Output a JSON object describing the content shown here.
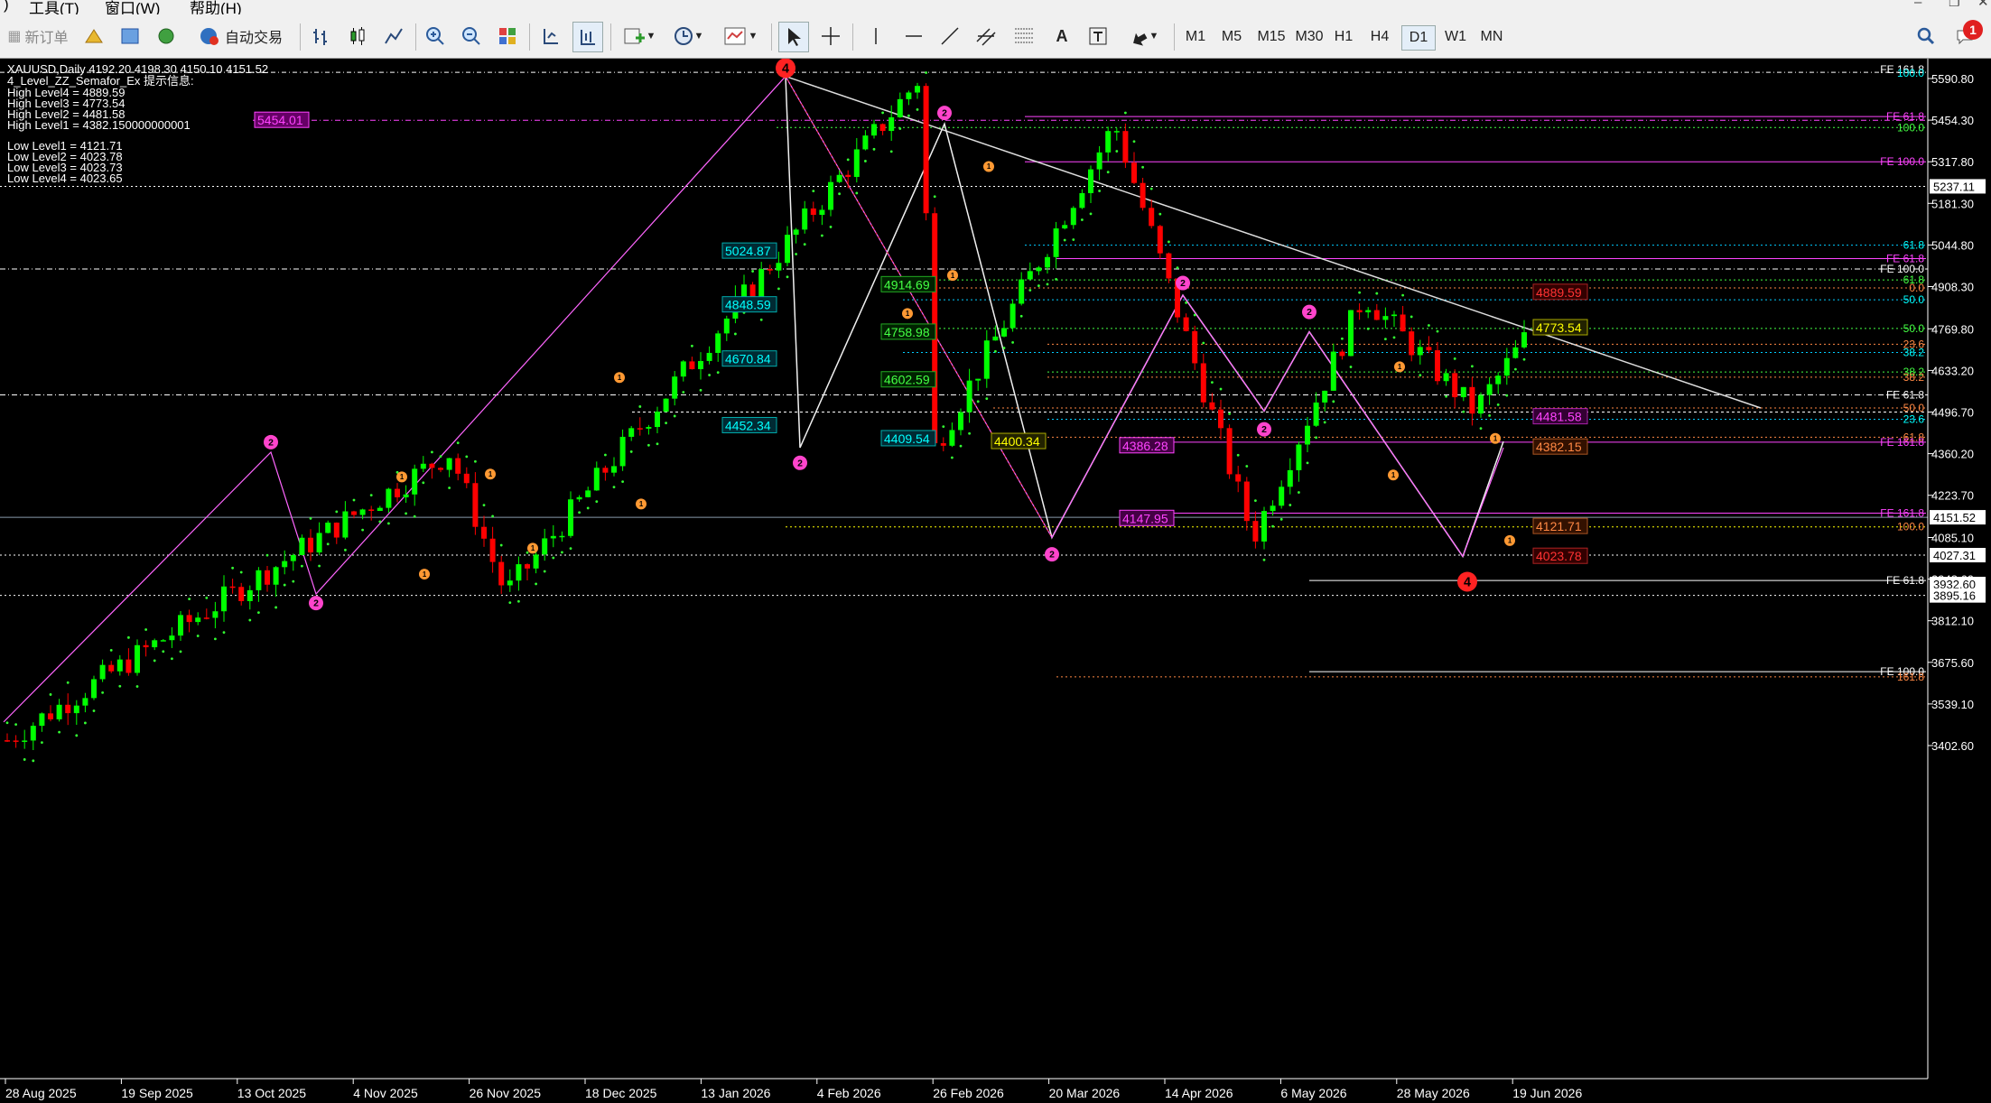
{
  "menu": {
    "tools": "工具(T)",
    "window": "窗口(W)",
    "help": "帮助(H)"
  },
  "toolbar": {
    "new_order": "新订单",
    "auto_trading": "自动交易",
    "timeframes": [
      "M1",
      "M5",
      "M15",
      "M30",
      "H1",
      "H4",
      "D1",
      "W1",
      "MN"
    ],
    "active_timeframe": "D1",
    "notification_count": "1"
  },
  "chart_info": {
    "header": "XAUUSD,Daily  4192.20 4198.30 4150.10 4151.52",
    "indicator_title": "4_Level_ZZ_Semafor_Ex 提示信息:",
    "high_levels": [
      "High Level4 = 4889.59",
      "High Level3 = 4773.54",
      "High Level2 = 4481.58",
      "High Level1 = 4382.150000000001"
    ],
    "low_levels": [
      "Low Level1 = 4121.71",
      "Low Level2 = 4023.78",
      "Low Level3 = 4023.73",
      "Low Level4 = 4023.65"
    ]
  },
  "chart_data": {
    "type": "candlestick",
    "symbol": "XAUUSD",
    "timeframe": "Daily",
    "ohlc_last": {
      "open": 4192.2,
      "high": 4198.3,
      "low": 4150.1,
      "close": 4151.52
    },
    "ylim": [
      3340,
      5660
    ],
    "x_dates": [
      "28 Aug 2025",
      "19 Sep 2025",
      "13 Oct 2025",
      "4 Nov 2025",
      "26 Nov 2025",
      "18 Dec 2025",
      "13 Jan 2026",
      "4 Feb 2026",
      "26 Feb 2026",
      "20 Mar 2026",
      "14 Apr 2026",
      "6 May 2026",
      "28 May 2026",
      "19 Jun 2026"
    ],
    "y_ticks": [
      5590.8,
      5454.3,
      5317.8,
      5181.3,
      5044.8,
      4908.3,
      4769.8,
      4633.2,
      4496.7,
      4360.2,
      4223.7,
      4085.1,
      3948.6,
      3812.1,
      3675.6,
      3539.1,
      3402.6
    ],
    "price_tags": [
      {
        "value": 5237.11,
        "text": "5237.11"
      },
      {
        "value": 4151.52,
        "text": "4151.52"
      },
      {
        "value": 4027.31,
        "text": "4027.31"
      },
      {
        "value": 3932.6,
        "text": "3932.60"
      },
      {
        "value": 3895.16,
        "text": "3895.16"
      }
    ],
    "labels": [
      {
        "text": "5454.01",
        "y": 5454.01,
        "color": "#ff44ff",
        "border": "#ff44ff",
        "fill": "#660066"
      },
      {
        "text": "5024.87",
        "y": 5024.87,
        "color": "#00ffff",
        "border": "#00aaaa",
        "fill": "#002a33"
      },
      {
        "text": "4914.69",
        "y": 4914.69,
        "color": "#44ff44",
        "border": "#22aa22",
        "fill": "#002200"
      },
      {
        "text": "4848.59",
        "y": 4848.59,
        "color": "#00ffff",
        "border": "#00aaaa",
        "fill": "#002a33"
      },
      {
        "text": "4758.98",
        "y": 4758.98,
        "color": "#44ff44",
        "border": "#22aa22",
        "fill": "#002200"
      },
      {
        "text": "4670.84",
        "y": 4670.84,
        "color": "#00ffff",
        "border": "#00aaaa",
        "fill": "#002a33"
      },
      {
        "text": "4602.59",
        "y": 4602.59,
        "color": "#44ff44",
        "border": "#22aa22",
        "fill": "#002200"
      },
      {
        "text": "4452.34",
        "y": 4452.34,
        "color": "#00ffff",
        "border": "#00aaaa",
        "fill": "#002a33"
      },
      {
        "text": "4409.54",
        "y": 4409.54,
        "color": "#00ffff",
        "border": "#00aaaa",
        "fill": "#002a33"
      },
      {
        "text": "4400.34",
        "y": 4400.34,
        "color": "#ffff00",
        "border": "#aaaa00",
        "fill": "#222200"
      },
      {
        "text": "4386.28",
        "y": 4386.28,
        "color": "#ff44ff",
        "border": "#ff44ff",
        "fill": "#440044"
      },
      {
        "text": "4147.95",
        "y": 4147.95,
        "color": "#ff44ff",
        "border": "#ff44ff",
        "fill": "#440044"
      },
      {
        "text": "4889.59",
        "y": 4889.59,
        "color": "#ff3333",
        "border": "#aa2222",
        "fill": "#330000"
      },
      {
        "text": "4773.54",
        "y": 4773.54,
        "color": "#ffff00",
        "border": "#aaaa00",
        "fill": "#222200"
      },
      {
        "text": "4481.58",
        "y": 4481.58,
        "color": "#ff44ff",
        "border": "#aa22aa",
        "fill": "#330033"
      },
      {
        "text": "4382.15",
        "y": 4382.15,
        "color": "#ff8844",
        "border": "#aa5522",
        "fill": "#331100"
      },
      {
        "text": "4121.71",
        "y": 4121.71,
        "color": "#ff8844",
        "border": "#aa5522",
        "fill": "#331100"
      },
      {
        "text": "4023.78",
        "y": 4023.78,
        "color": "#ff3333",
        "border": "#aa2222",
        "fill": "#330000"
      }
    ],
    "fib_labels": [
      {
        "text": "FE 161.8",
        "y": 5620,
        "color": "#ffffff"
      },
      {
        "text": "100.0",
        "y": 5608,
        "color": "#00ffff"
      },
      {
        "text": "FE 61.8",
        "y": 5466,
        "color": "#ff44ff"
      },
      {
        "text": "100.0",
        "y": 5430,
        "color": "#44ff44"
      },
      {
        "text": "FE 100.0",
        "y": 5317.8,
        "color": "#ff44ff"
      },
      {
        "text": "61.8",
        "y": 5044,
        "color": "#00ffff"
      },
      {
        "text": "FE 61.8",
        "y": 5000,
        "color": "#ff44ff"
      },
      {
        "text": "FE 100.0",
        "y": 4966,
        "color": "#ffffff"
      },
      {
        "text": "61.8",
        "y": 4930,
        "color": "#44ff44"
      },
      {
        "text": "0.0",
        "y": 4904,
        "color": "#ff8844"
      },
      {
        "text": "50.0",
        "y": 4865,
        "color": "#00ffff"
      },
      {
        "text": "50.0",
        "y": 4771,
        "color": "#44ff44"
      },
      {
        "text": "23.6",
        "y": 4719,
        "color": "#ff8844"
      },
      {
        "text": "38.2",
        "y": 4692,
        "color": "#00ffff"
      },
      {
        "text": "38.2",
        "y": 4628,
        "color": "#44ff44"
      },
      {
        "text": "38.2",
        "y": 4611,
        "color": "#ff8844"
      },
      {
        "text": "FE 61.8",
        "y": 4553,
        "color": "#ffffff"
      },
      {
        "text": "50.0",
        "y": 4510,
        "color": "#ff8844"
      },
      {
        "text": "23.6",
        "y": 4473,
        "color": "#00ffff"
      },
      {
        "text": "61.8",
        "y": 4414,
        "color": "#ff8844"
      },
      {
        "text": "FE 161.8",
        "y": 4398,
        "color": "#ff44ff"
      },
      {
        "text": "FE 161.8",
        "y": 4165,
        "color": "#ff44ff"
      },
      {
        "text": "100.0",
        "y": 4120,
        "color": "#ff8844"
      },
      {
        "text": "FE 61.8",
        "y": 3944,
        "color": "#ffffff"
      },
      {
        "text": "FE 100.0",
        "y": 3645,
        "color": "#ffffff"
      },
      {
        "text": "161.8",
        "y": 3628,
        "color": "#ff8844"
      }
    ],
    "semafor_markers": [
      {
        "label": "4",
        "date_index": 13.8,
        "price": 5625,
        "color": "#ff2222",
        "size": "big"
      },
      {
        "label": "2",
        "date_index": 5.2,
        "price": 4398,
        "color": "#ff44cc",
        "size": "mid"
      },
      {
        "label": "2",
        "date_index": 6.3,
        "price": 3870,
        "color": "#ff44cc",
        "size": "mid"
      },
      {
        "label": "2",
        "date_index": 14.2,
        "price": 4330,
        "color": "#ff44cc",
        "size": "mid"
      },
      {
        "label": "2",
        "date_index": 16.8,
        "price": 5478,
        "color": "#ff44cc",
        "size": "mid"
      },
      {
        "label": "2",
        "date_index": 18.9,
        "price": 4030,
        "color": "#ff44cc",
        "size": "mid"
      },
      {
        "label": "2",
        "date_index": 21.2,
        "price": 4920,
        "color": "#ff44cc",
        "size": "mid"
      },
      {
        "label": "2",
        "date_index": 22.6,
        "price": 4440,
        "color": "#ff44cc",
        "size": "mid"
      },
      {
        "label": "2",
        "date_index": 23.4,
        "price": 4825,
        "color": "#ff44cc",
        "size": "mid"
      },
      {
        "label": "4",
        "date_index": 26.3,
        "price": 3940,
        "color": "#ff2222",
        "size": "big"
      },
      {
        "label": "1",
        "date_index": 7.2,
        "price": 4284,
        "color": "#ff9933",
        "size": "small"
      },
      {
        "label": "1",
        "date_index": 7.6,
        "price": 3965,
        "color": "#ff9933",
        "size": "small"
      },
      {
        "label": "1",
        "date_index": 8.7,
        "price": 4293,
        "color": "#ff9933",
        "size": "small"
      },
      {
        "label": "1",
        "date_index": 9.5,
        "price": 4050,
        "color": "#ff9933",
        "size": "small"
      },
      {
        "label": "1",
        "date_index": 11.1,
        "price": 4610,
        "color": "#ff9933",
        "size": "small"
      },
      {
        "label": "1",
        "date_index": 11.5,
        "price": 4195,
        "color": "#ff9933",
        "size": "small"
      },
      {
        "label": "1",
        "date_index": 15.8,
        "price": 4820,
        "color": "#ff9933",
        "size": "small"
      },
      {
        "label": "1",
        "date_index": 17.0,
        "price": 4945,
        "color": "#ff9933",
        "size": "small"
      },
      {
        "label": "1",
        "date_index": 17.7,
        "price": 5302,
        "color": "#ff9933",
        "size": "small"
      },
      {
        "label": "1",
        "date_index": 25.1,
        "price": 4645,
        "color": "#ff9933",
        "size": "small"
      },
      {
        "label": "1",
        "date_index": 25.0,
        "price": 4290,
        "color": "#ff9933",
        "size": "small"
      },
      {
        "label": "1",
        "date_index": 26.8,
        "price": 4410,
        "color": "#ff9933",
        "size": "small"
      },
      {
        "label": "1",
        "date_index": 27.1,
        "price": 4075,
        "color": "#ff9933",
        "size": "small"
      }
    ],
    "grid": false,
    "colors": {
      "bull": "#00ff00",
      "bear": "#ff0000",
      "background": "#000000",
      "foreground": "#ffffff"
    }
  }
}
